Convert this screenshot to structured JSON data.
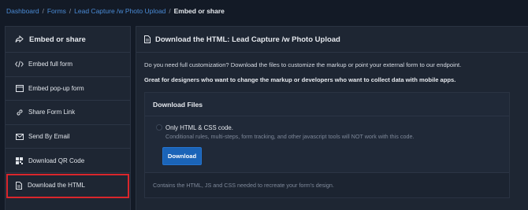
{
  "breadcrumb": {
    "items": [
      "Dashboard",
      "Forms",
      "Lead Capture /w Photo Upload"
    ],
    "current": "Embed or share",
    "separator": "/"
  },
  "sidebar": {
    "title": "Embed or share",
    "items": [
      {
        "label": "Embed full form",
        "icon": "code-icon"
      },
      {
        "label": "Embed pop-up form",
        "icon": "window-icon"
      },
      {
        "label": "Share Form Link",
        "icon": "link-icon"
      },
      {
        "label": "Send By Email",
        "icon": "envelope-icon"
      },
      {
        "label": "Download QR Code",
        "icon": "qr-code-icon"
      },
      {
        "label": "Download the HTML",
        "icon": "file-icon",
        "active": true
      }
    ]
  },
  "main": {
    "title": "Download the HTML: Lead Capture /w Photo Upload",
    "description": "Do you need full customization? Download the files to customize the markup or point your external form to our endpoint.",
    "note": "Great for designers who want to change the markup or developers who want to collect data with mobile apps.",
    "card": {
      "title": "Download Files",
      "option_title": "Only HTML & CSS code.",
      "option_subtitle": "Conditional rules, multi-steps, form tracking, and other javascript tools will NOT work with this code.",
      "button_label": "Download",
      "footer": "Contains the HTML, JS and CSS needed to recreate your form's design."
    }
  },
  "colors": {
    "background": "#131a26",
    "panel": "#1e2633",
    "accent": "#1b64b8",
    "link": "#4a8bd6",
    "highlight": "#d9262c"
  }
}
